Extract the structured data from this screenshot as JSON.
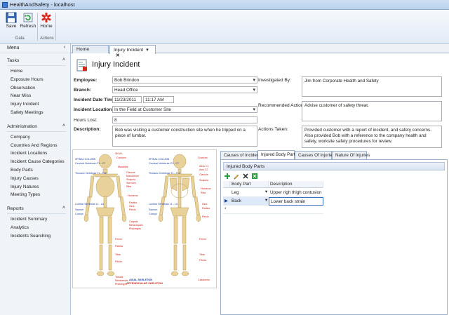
{
  "window": {
    "title": "HealthAndSafety - localhost"
  },
  "ribbon": {
    "buttons": [
      {
        "label": "Save",
        "icon": "save-icon"
      },
      {
        "label": "Refresh",
        "icon": "refresh-icon"
      },
      {
        "label": "Home",
        "icon": "home-icon"
      }
    ],
    "groups": {
      "data": "Data",
      "actions": "Actions"
    }
  },
  "sidebar": {
    "menu_label": "Menu",
    "sections": [
      {
        "title": "Tasks",
        "items": [
          "Home",
          "Exposure Hours",
          "Observation",
          "Near Miss",
          "Injury Incident",
          "Safety Meetings"
        ]
      },
      {
        "title": "Administration",
        "items": [
          "Company",
          "Countries And Regions",
          "Incident Locations",
          "Incident Cause Categories",
          "Body Parts",
          "Injury Causes",
          "Injury Natures",
          "Meeting Types"
        ]
      },
      {
        "title": "Reports",
        "items": [
          "Incident Summary",
          "Analytics",
          "Incidents Searching"
        ]
      }
    ]
  },
  "tabs": {
    "home": "Home",
    "active": "Injury Incident",
    "active_arrow": "▾",
    "close": "✕"
  },
  "page": {
    "title": "Injury Incident"
  },
  "form": {
    "employee_label": "Employee:",
    "employee_value": "Bob Brindon",
    "branch_label": "Branch:",
    "branch_value": "Head Office",
    "date_label": "Incident Date Time:",
    "date_value": "11/23/2011",
    "time_value": "11:17 AM",
    "location_label": "Incident Location:",
    "location_value": "In the Field at Customer Site",
    "hours_label": "Hours Lost:",
    "hours_value": "8",
    "description_label": "Description:",
    "description_value": "Bob was visiting a customer construction site when he tripped on a piece of lumbar.",
    "investigated_label": "Investigated By:",
    "investigated_value": "Jim from Corporate Health and Safety",
    "recommended_label": "Recommended Actions:",
    "recommended_value": "Advise customer of safety threat.",
    "actions_label": "Actions Taken:",
    "actions_value": "Provided customer with a report of incident, and safety concerns. Also provided Bob with a reference to the company health and safety, worksite safety procedures for review."
  },
  "skeleton": {
    "left_labels": [
      "SPINAL COLUMN",
      "Cervical Vertebrae C1 - C7",
      "Thoracic Vertebrae T1 - T12",
      "Lumbar Vertebrae L1 - L5",
      "Sacrum",
      "Coccyx"
    ],
    "front_labels": [
      "SKULL",
      "Cranium",
      "Mandible",
      "Clavicle",
      "Manubrium",
      "Scapula",
      "Sternum",
      "Ribs",
      "Humerus",
      "Radius",
      "Ulna",
      "Pelvis",
      "Carpals",
      "Metacarpals",
      "Phalanges",
      "Femur",
      "Patella",
      "Tibia",
      "Fibula",
      "Tarsals",
      "Metatarsals",
      "Phalanges"
    ],
    "mid_labels": [
      "SPINAL COLUMN",
      "Cervical Vertebrae C1 - C7",
      "Thoracic Vertebrae T1 - T12",
      "Lumbar Vertebrae L1 - L5",
      "Sacrum",
      "Coccyx"
    ],
    "back_labels": [
      "Cranium",
      "Atlas C1",
      "Axis C2",
      "Clavicle",
      "Scapula",
      "Humerus",
      "Ribs",
      "Ulna",
      "Radius",
      "Pelvis",
      "Femur",
      "Tibia",
      "Fibula",
      "Calcaneus"
    ],
    "caption1": "AXIAL SKELETON",
    "caption2": "APPENDICULAR SKELETON"
  },
  "panel": {
    "tabs": [
      "Causes of Incident",
      "Injured Body Parts",
      "Causes Of Injuries",
      "Nature Of Injuries"
    ],
    "active_tab": 1,
    "grid_title": "Injured Body Parts",
    "tools": [
      "add-icon",
      "edit-icon",
      "delete-icon",
      "export-icon"
    ],
    "columns": [
      "Body Part",
      "Description"
    ],
    "rows": [
      {
        "body_part": "Leg",
        "description": "Upper righ thigh contusion",
        "selected": false
      },
      {
        "body_part": "Back",
        "description": "Lower back strain",
        "selected": true
      }
    ],
    "new_row_marker": "*",
    "selected_marker": "▶"
  }
}
